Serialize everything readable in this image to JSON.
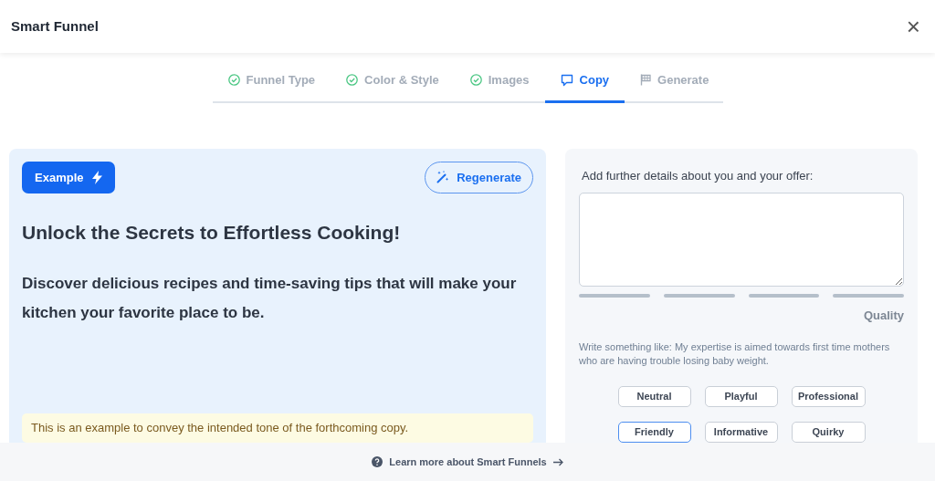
{
  "window": {
    "title": "Smart Funnel",
    "close": "×"
  },
  "steps": [
    {
      "label": "Funnel Type",
      "kind": "done",
      "selected": false
    },
    {
      "label": "Color & Style",
      "kind": "done",
      "selected": false
    },
    {
      "label": "Images",
      "kind": "done",
      "selected": false
    },
    {
      "label": "Copy",
      "kind": "current",
      "selected": true
    },
    {
      "label": "Generate",
      "kind": "pending",
      "selected": false
    }
  ],
  "example": {
    "badge": "Example",
    "regenerate": "Regenerate",
    "headline": "Unlock the Secrets to Effortless Cooking!",
    "subheadline": "Discover delicious recipes and time-saving tips that will make your kitchen your favorite place to be.",
    "note": "This is an example to convey the intended tone of the forthcoming copy."
  },
  "details": {
    "label": "Add further details about you and your offer:",
    "quality": {
      "label": "Quality",
      "level": 0
    },
    "hint": "Write something like: My expertise is aimed towards first time mothers who are having trouble losing baby weight."
  },
  "tones": [
    {
      "label": "Neutral",
      "selected": false
    },
    {
      "label": "Playful",
      "selected": false
    },
    {
      "label": "Professional",
      "selected": false
    },
    {
      "label": "Friendly",
      "selected": true
    },
    {
      "label": "Informative",
      "selected": false
    },
    {
      "label": "Quirky",
      "selected": false
    }
  ],
  "footer": {
    "link": "Learn more about Smart Funnels"
  }
}
